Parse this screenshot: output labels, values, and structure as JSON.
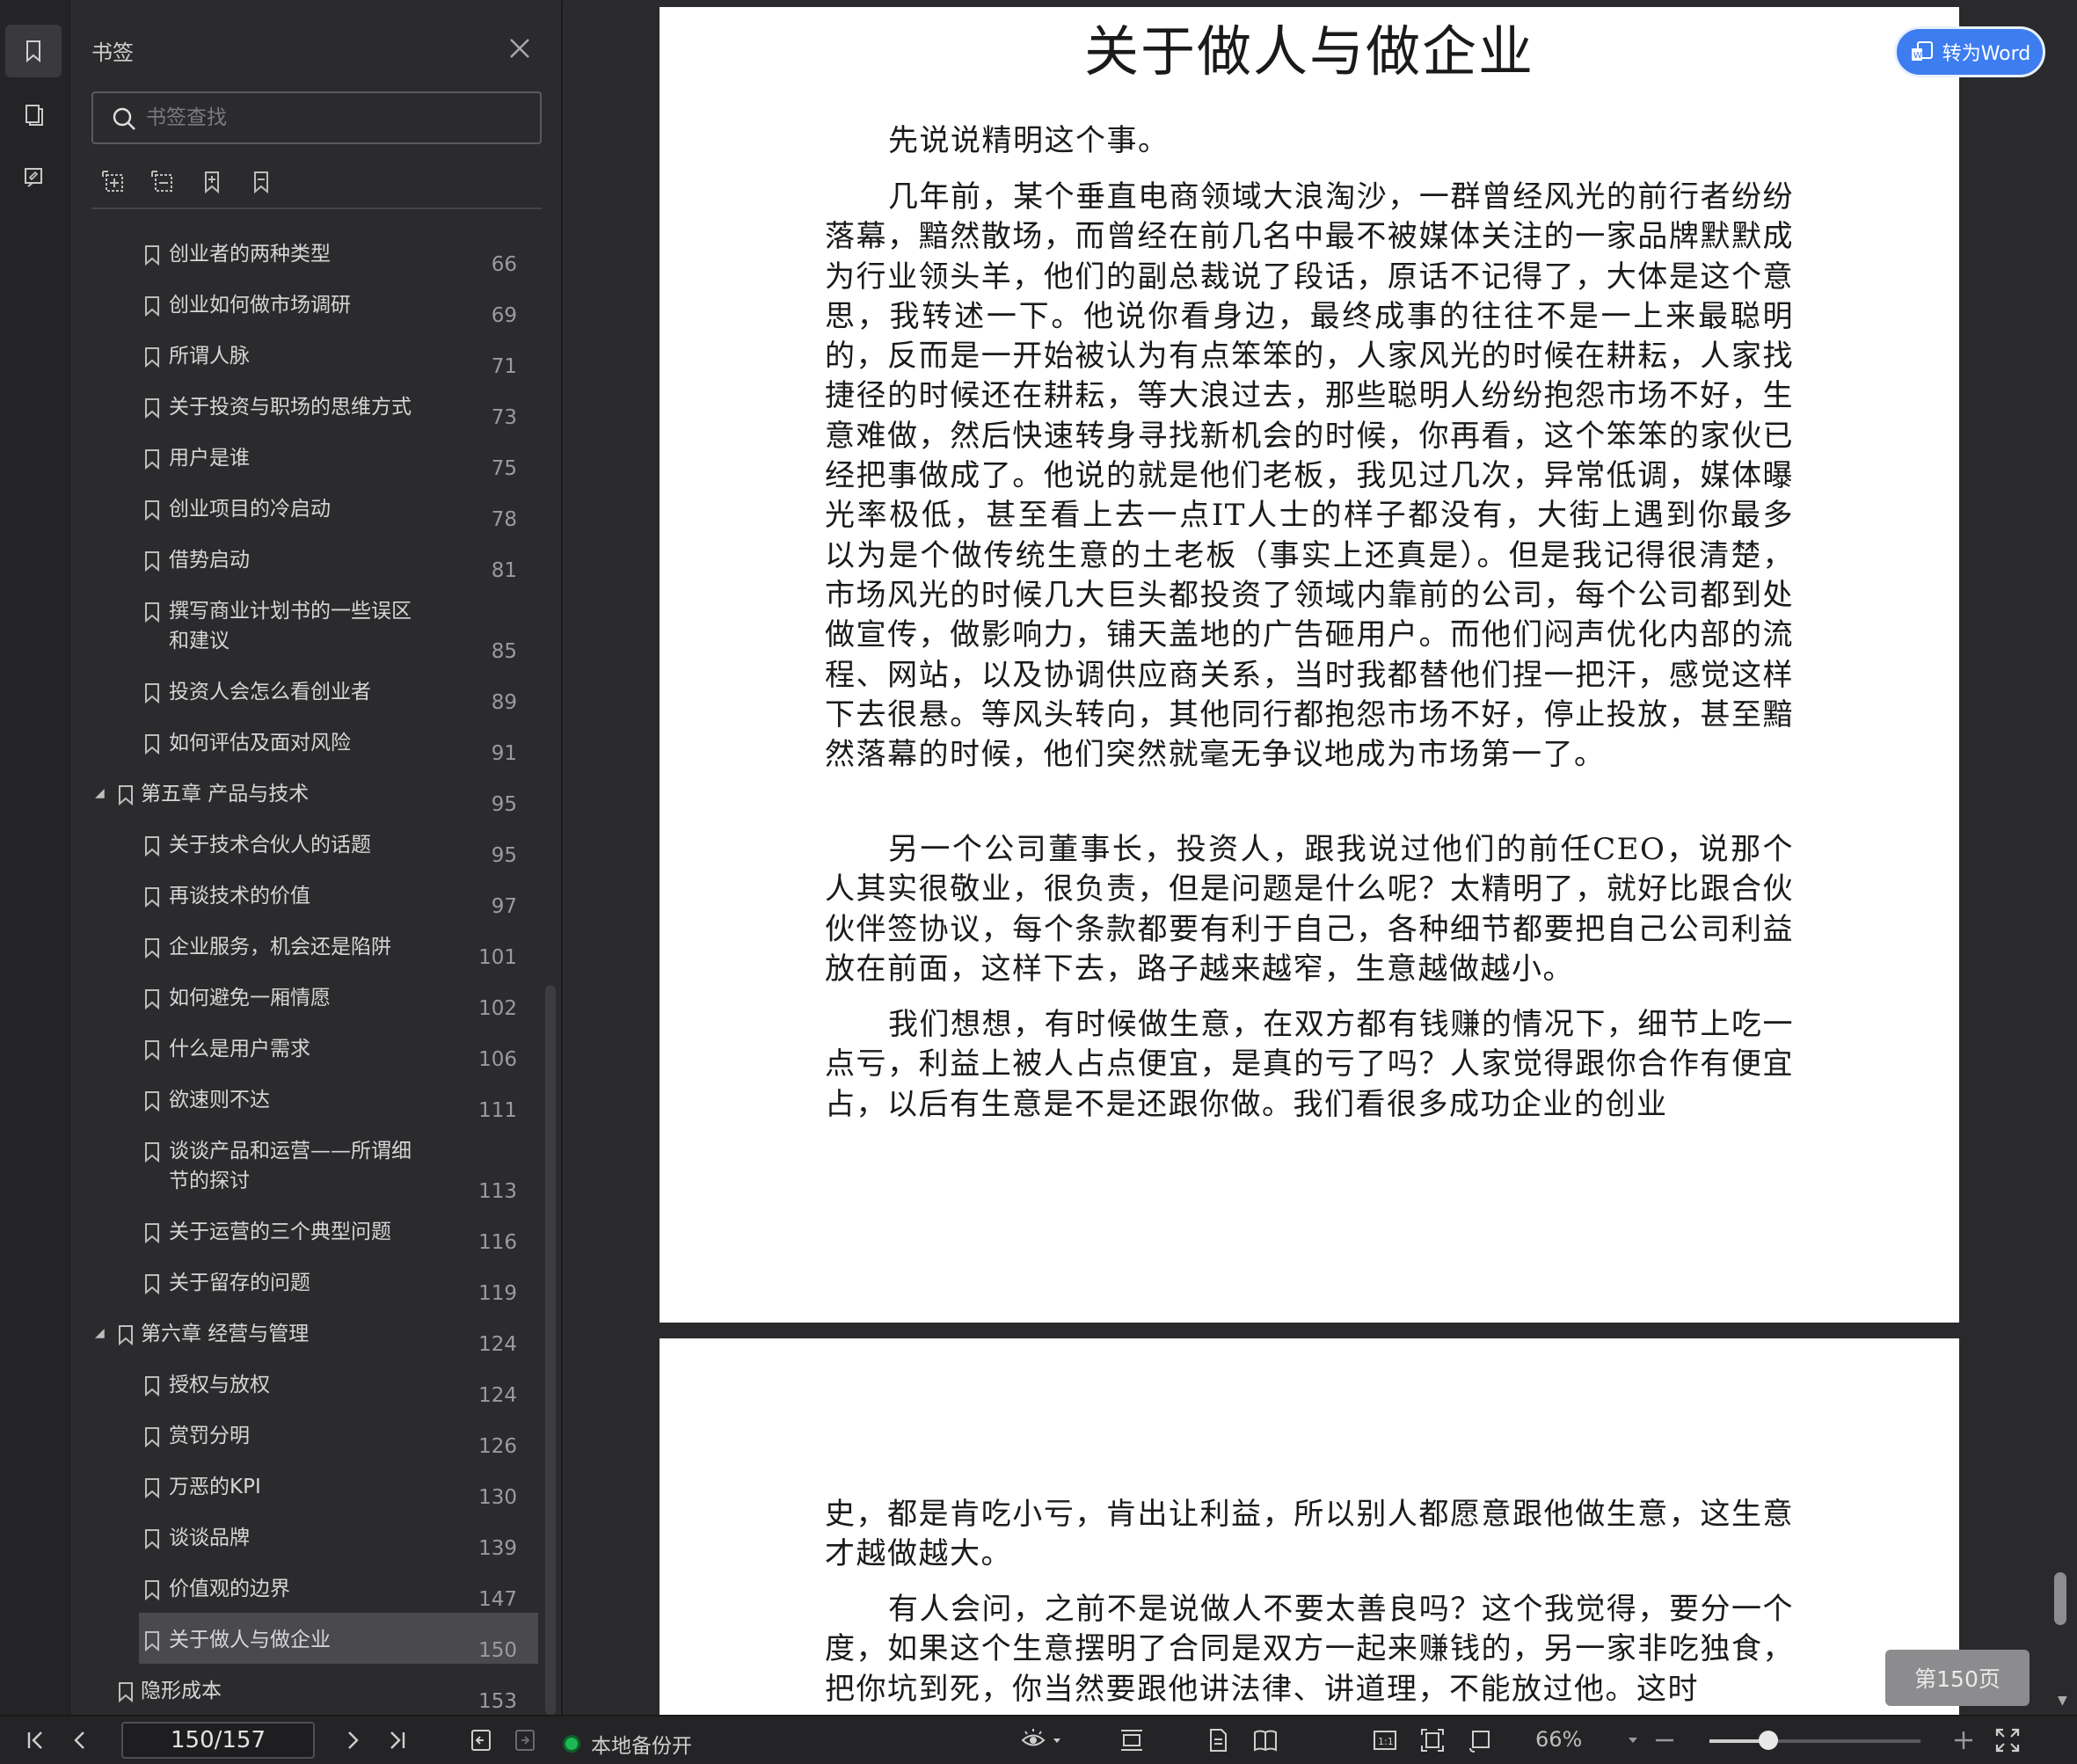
{
  "sidebar": {
    "title": "书签",
    "search_placeholder": "书签查找",
    "bookmarks": [
      {
        "label": "创业者的两种类型",
        "page": "66",
        "level": 2
      },
      {
        "label": "创业如何做市场调研",
        "page": "69",
        "level": 2
      },
      {
        "label": "所谓人脉",
        "page": "71",
        "level": 2
      },
      {
        "label": "关于投资与职场的思维方式",
        "page": "73",
        "level": 2
      },
      {
        "label": "用户是谁",
        "page": "75",
        "level": 2
      },
      {
        "label": "创业项目的冷启动",
        "page": "78",
        "level": 2
      },
      {
        "label": "借势启动",
        "page": "81",
        "level": 2
      },
      {
        "label": "撰写商业计划书的一些误区",
        "label2": "和建议",
        "page": "85",
        "level": 2
      },
      {
        "label": "投资人会怎么看创业者",
        "page": "89",
        "level": 2
      },
      {
        "label": "如何评估及面对风险",
        "page": "91",
        "level": 2
      },
      {
        "label": "第五章 产品与技术",
        "page": "95",
        "level": 1
      },
      {
        "label": "关于技术合伙人的话题",
        "page": "95",
        "level": 2
      },
      {
        "label": "再谈技术的价值",
        "page": "97",
        "level": 2
      },
      {
        "label": "企业服务，机会还是陷阱",
        "page": "101",
        "level": 2
      },
      {
        "label": "如何避免一厢情愿",
        "page": "102",
        "level": 2
      },
      {
        "label": "什么是用户需求",
        "page": "106",
        "level": 2
      },
      {
        "label": "欲速则不达",
        "page": "111",
        "level": 2
      },
      {
        "label": "谈谈产品和运营——所谓细",
        "label2": "节的探讨",
        "page": "113",
        "level": 2
      },
      {
        "label": "关于运营的三个典型问题",
        "page": "116",
        "level": 2
      },
      {
        "label": "关于留存的问题",
        "page": "119",
        "level": 2
      },
      {
        "label": "第六章 经营与管理",
        "page": "124",
        "level": 1
      },
      {
        "label": "授权与放权",
        "page": "124",
        "level": 2
      },
      {
        "label": "赏罚分明",
        "page": "126",
        "level": 2
      },
      {
        "label": "万恶的KPI",
        "page": "130",
        "level": 2
      },
      {
        "label": "谈谈品牌",
        "page": "139",
        "level": 2
      },
      {
        "label": "价值观的边界",
        "page": "147",
        "level": 2
      },
      {
        "label": "关于做人与做企业",
        "page": "150",
        "level": 2,
        "selected": true
      },
      {
        "label": "隐形成本",
        "page": "153",
        "level": 1.5
      }
    ]
  },
  "document": {
    "title": "关于做人与做企业",
    "paragraphs_page1": [
      "先说说精明这个事。",
      "几年前，某个垂直电商领域大浪淘沙，一群曾经风光的前行者纷纷落幕，黯然散场，而曾经在前几名中最不被媒体关注的一家品牌默默成为行业领头羊，他们的副总裁说了段话，原话不记得了，大体是这个意思，我转述一下。他说你看身边，最终成事的往往不是一上来最聪明的，反而是一开始被认为有点笨笨的，人家风光的时候在耕耘，人家找捷径的时候还在耕耘，等大浪过去，那些聪明人纷纷抱怨市场不好，生意难做，然后快速转身寻找新机会的时候，你再看，这个笨笨的家伙已经把事做成了。他说的就是他们老板，我见过几次，异常低调，媒体曝光率极低，甚至看上去一点IT人士的样子都没有，大街上遇到你最多以为是个做传统生意的土老板（事实上还真是）。但是我记得很清楚，市场风光的时候几大巨头都投资了领域内靠前的公司，每个公司都到处做宣传，做影响力，铺天盖地的广告砸用户。而他们闷声优化内部的流程、网站，以及协调供应商关系，当时我都替他们捏一把汗，感觉这样下去很悬。等风头转向，其他同行都抱怨市场不好，停止投放，甚至黯然落幕的时候，他们突然就毫无争议地成为市场第一了。",
      "另一个公司董事长，投资人，跟我说过他们的前任CEO，说那个人其实很敬业，很负责，但是问题是什么呢？太精明了，就好比跟合伙伙伴签协议，每个条款都要有利于自己，各种细节都要把自己公司利益放在前面，这样下去，路子越来越窄，生意越做越小。",
      "我们想想，有时候做生意，在双方都有钱赚的情况下，细节上吃一点亏，利益上被人占点便宜，是真的亏了吗？人家觉得跟你合作有便宜占，以后有生意是不是还跟你做。我们看很多成功企业的创业"
    ],
    "paragraphs_page2": [
      "史，都是肯吃小亏，肯出让利益，所以别人都愿意跟他做生意，这生意才越做越大。",
      "有人会问，之前不是说做人不要太善良吗？这个我觉得，要分一个度，如果这个生意摆明了合同是双方一起来赚钱的，另一家非吃独食，把你坑到死，你当然要跟他讲法律、讲道理，不能放过他。这时"
    ]
  },
  "to_word_label": "转为Word",
  "page_badge": "第150页",
  "bottombar": {
    "page_indicator": "150/157",
    "backup_label": "本地备份开",
    "zoom": "66%",
    "zoom_fraction": 0.28
  }
}
